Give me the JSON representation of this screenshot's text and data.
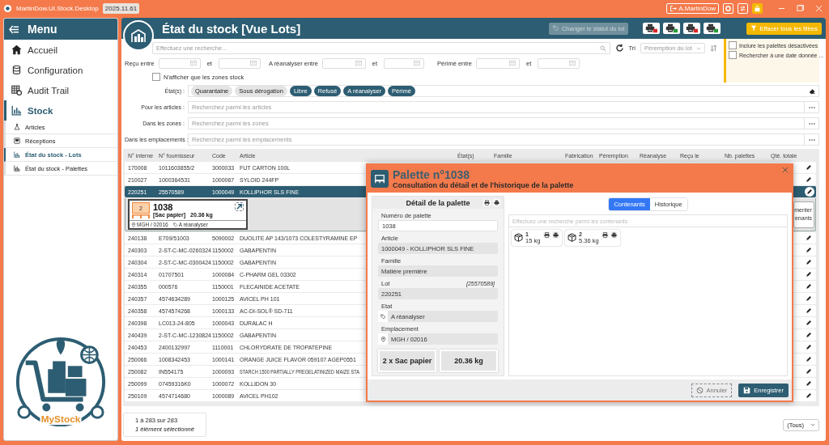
{
  "title_bar": {
    "app_name": "MartinDow.UI.Stock.Desktop",
    "version": "2025.11.61",
    "user": "A.MartinDow"
  },
  "sidebar": {
    "title": "Menu",
    "items": [
      {
        "label": "Accueil",
        "selected": false
      },
      {
        "label": "Configuration",
        "selected": false
      },
      {
        "label": "Audit Trail",
        "selected": false
      },
      {
        "label": "Stock",
        "selected": true,
        "children": [
          {
            "label": "Articles",
            "selected": false
          },
          {
            "label": "Réceptions",
            "selected": false
          },
          {
            "label": "État du stock - Lots",
            "selected": true
          },
          {
            "label": "État du stock - Palettes",
            "selected": false
          }
        ]
      }
    ],
    "logo_text": "MyStock"
  },
  "header": {
    "title": "État du stock [Vue Lots]",
    "status_button": {
      "label": "Changer le statut du lot",
      "disabled": true
    },
    "clear_button": "Effacer tous les filtres",
    "options": [
      {
        "label": "Inclure les palettes désactivées",
        "checked": false
      },
      {
        "label": "Rechercher à une date donnée ...",
        "checked": false
      }
    ]
  },
  "filters": {
    "search_placeholder": "Effectuez une recherche...",
    "sort_label": "Tri",
    "sort_placeholder": "Péremption du lot",
    "date_ranges": [
      {
        "label": "Reçu entre",
        "between": "et"
      },
      {
        "label": "A réanalyser entre",
        "between": "et"
      },
      {
        "label": "Périmé entre",
        "between": "et"
      }
    ],
    "zones_only": {
      "label": "N'afficher que les zones stock",
      "checked": false
    },
    "states_label": "État(s) :",
    "states": [
      {
        "label": "Quarantaine",
        "selected": false
      },
      {
        "label": "Sous dérogation",
        "selected": false
      },
      {
        "label": "Libre",
        "selected": true
      },
      {
        "label": "Refusé",
        "selected": true
      },
      {
        "label": "A réanalyser",
        "selected": true
      },
      {
        "label": "Périmé",
        "selected": true
      }
    ],
    "lookups": [
      {
        "label": "Pour les articles :",
        "placeholder": "Recherchez parmi les articles"
      },
      {
        "label": "Dans les zones :",
        "placeholder": "Recherchez parmi les zones"
      },
      {
        "label": "Dans les emplacements :",
        "placeholder": "Recherchez parmi les emplacements"
      }
    ]
  },
  "table": {
    "columns": [
      "N° interne",
      "N° fournisseur",
      "Code",
      "Article",
      "État(s)",
      "Famille",
      "Fabrication",
      "Péremption",
      "Réanalyse",
      "Reçu le",
      "Nb. palettes",
      "Qté. totale"
    ],
    "rows": [
      {
        "cells": [
          "170008",
          "1011603855/2",
          "3000033",
          "FUT CARTON 100L"
        ],
        "selected": false
      },
      {
        "cells": [
          "210027",
          "1000364531",
          "1000067",
          "SYLOID 244FP"
        ],
        "selected": false
      },
      {
        "cells": [
          "220251",
          "25570589",
          "1000049",
          "KOLLIPHOR SLS FINE"
        ],
        "selected": true,
        "detail": {
          "count": "2",
          "number": "1038",
          "packaging": "[Sac papier]",
          "weight": "20.36 kg",
          "location": "MGH / 02016",
          "status": "A réanalyser",
          "side_lines": [
            "menter",
            "enants"
          ]
        }
      },
      {
        "cells": [
          "240138",
          "E709/51003",
          "5090002",
          "DUOLITE AP 143/1073 COLESTYRAMINE EP"
        ],
        "selected": false
      },
      {
        "cells": [
          "240303",
          "2-ST-C-MC-0260324",
          "1150002",
          "GABAPENTIN"
        ],
        "selected": false
      },
      {
        "cells": [
          "240304",
          "2-ST-C-MC-0300424",
          "1150002",
          "GABAPENTIN"
        ],
        "selected": false
      },
      {
        "cells": [
          "240314",
          "01707501",
          "1000084",
          "C-PHARM GEL 03302"
        ],
        "selected": false
      },
      {
        "cells": [
          "240355",
          "000576",
          "1150001",
          "FLECAINIDE ACETATE"
        ],
        "selected": false
      },
      {
        "cells": [
          "240357",
          "4574634289",
          "1000125",
          "AVICEL PH 101"
        ],
        "selected": false
      },
      {
        "cells": [
          "240358",
          "4574574268",
          "1000133",
          "AC-DI-SOL® SD-711"
        ],
        "selected": false
      },
      {
        "cells": [
          "240398",
          "LC013-24-805",
          "1000043",
          "DURALAC H"
        ],
        "selected": false
      },
      {
        "cells": [
          "240439",
          "2-ST-C-MC-1230824",
          "1150002",
          "GABAPENTIN"
        ],
        "selected": false
      },
      {
        "cells": [
          "240453",
          "2400132997",
          "1110001",
          "CHLORYDRATE DE TROPATEPINE"
        ],
        "selected": false
      },
      {
        "cells": [
          "250066",
          "1008342453",
          "1000141",
          "ORANGE JUICE FLAVOR 059107 AGEP0551"
        ],
        "selected": false
      },
      {
        "cells": [
          "250082",
          "IN554175",
          "1000093",
          "STARCH 1500 PARTIALLY PREGELATINIZED MAIZE STA"
        ],
        "selected": false
      },
      {
        "cells": [
          "250099",
          "07459316K0",
          "1000072",
          "KOLLIDON 30"
        ],
        "selected": false
      },
      {
        "cells": [
          "250109",
          "4574714680",
          "1000089",
          "AVICEL PH102"
        ],
        "selected": false
      }
    ]
  },
  "footer": {
    "range": "1 à 283 sur 283",
    "selection": "1 élément sélectionné",
    "filter": "(Tous)"
  },
  "dialog": {
    "title": "Palette n°1038",
    "subtitle": "Consultation du détail et de l'historique de la palette",
    "detail_title": "Détail de la palette",
    "fields": [
      {
        "label": "Numéro de palette",
        "value": "1038",
        "kind": "input"
      },
      {
        "label": "Article",
        "value": "1000049 - KOLLIPHOR SLS FINE",
        "kind": "readonly"
      },
      {
        "label": "Famille",
        "value": "Matière première",
        "kind": "readonly"
      },
      {
        "label": "Lot",
        "note": "[25570589]",
        "value": "220251",
        "kind": "readonly"
      },
      {
        "label": "Etat",
        "value": "A réanalyser",
        "kind": "tag"
      },
      {
        "label": "Emplacement",
        "value": "MGH / 02016",
        "kind": "location"
      }
    ],
    "totals": [
      "2 x Sac papier",
      "20.36 kg"
    ],
    "tabs": [
      {
        "label": "Contenants",
        "selected": true
      },
      {
        "label": "Historique",
        "selected": false
      }
    ],
    "search_placeholder": "Effectuez une recherche parmi les contenants",
    "containers": [
      {
        "number": "1",
        "weight": "15 kg"
      },
      {
        "number": "2",
        "weight": "5.36 kg"
      }
    ],
    "cancel": "Annuler",
    "save": "Enregistrer"
  }
}
